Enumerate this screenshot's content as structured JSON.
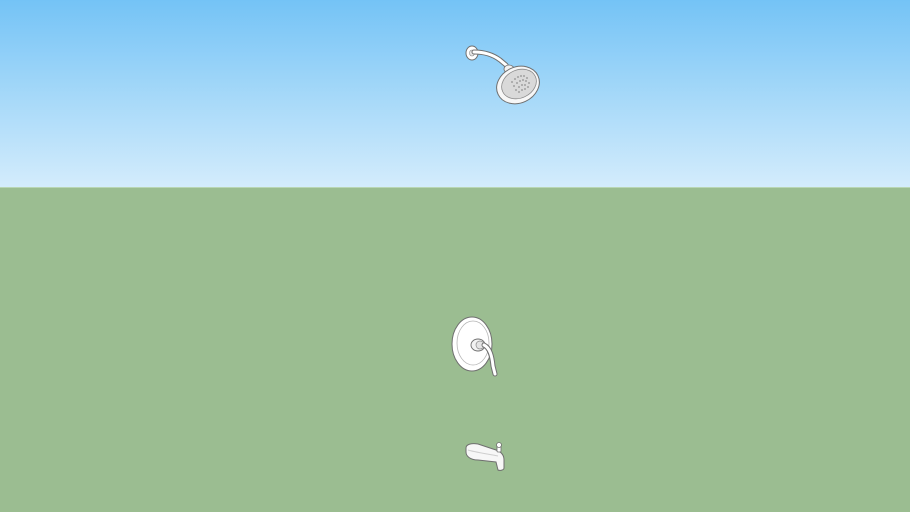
{
  "scene": {
    "colors": {
      "sky_top": "#74c3f6",
      "sky_bottom": "#d4ecfc",
      "ground": "#9bbd91",
      "fixture_fill": "#ffffff",
      "fixture_outline": "#6f6f6f"
    },
    "objects": [
      {
        "name": "shower-head",
        "icon": "shower-head-icon"
      },
      {
        "name": "valve-trim",
        "icon": "shower-valve-handle-icon"
      },
      {
        "name": "tub-spout",
        "icon": "tub-spout-icon"
      }
    ]
  }
}
